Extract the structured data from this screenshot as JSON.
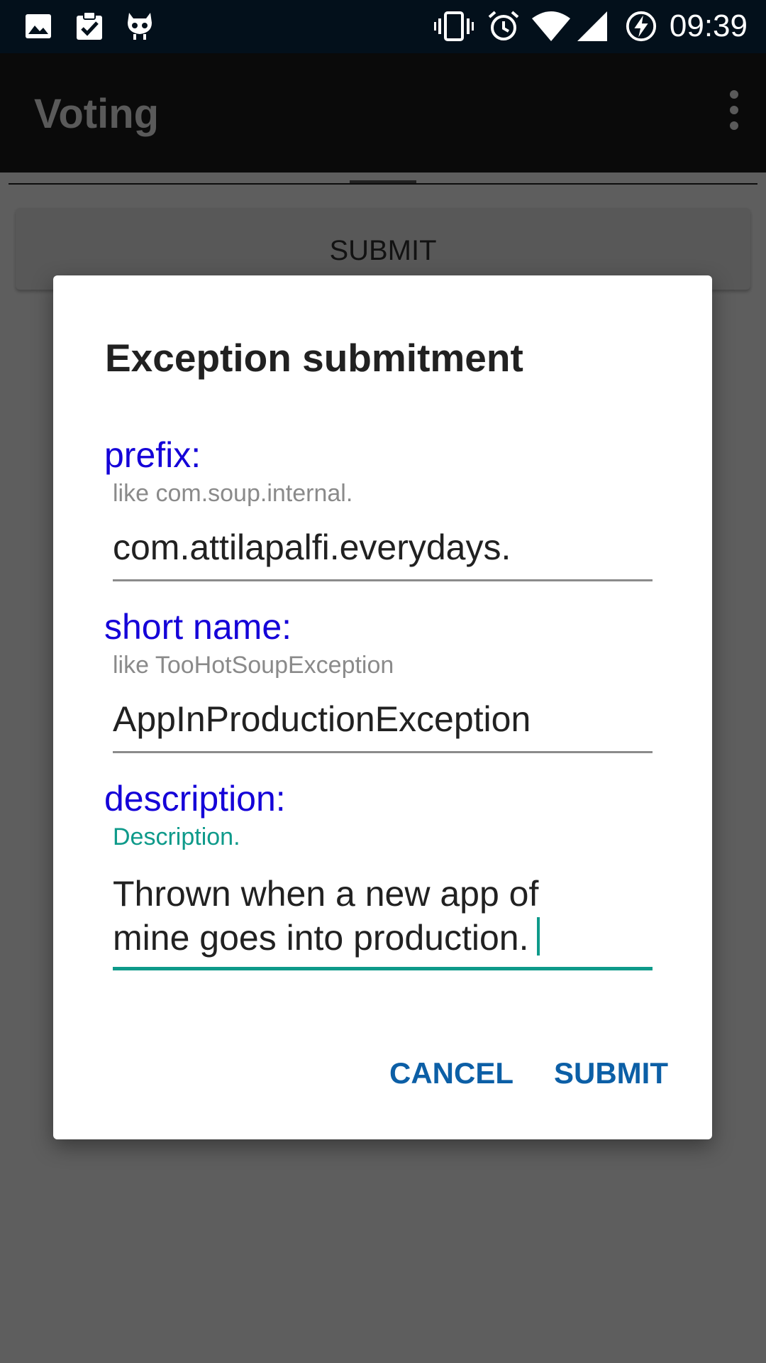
{
  "status_bar": {
    "time": "09:39",
    "icons": [
      "image-icon",
      "clipboard-check-icon",
      "cyanogen-mod-icon",
      "vibrate-icon",
      "alarm-icon",
      "wifi-icon",
      "signal-icon",
      "battery-charging-icon"
    ]
  },
  "app_bar": {
    "title": "Voting",
    "menu_icon": "overflow-menu-icon"
  },
  "background": {
    "submit_label": "SUBMIT"
  },
  "dialog": {
    "title": "Exception submitment",
    "fields": [
      {
        "label": "prefix:",
        "hint": "like com.soup.internal.",
        "value": "com.attilapalfi.everydays."
      },
      {
        "label": "short name:",
        "hint": "like TooHotSoupException",
        "value": "AppInProductionException"
      },
      {
        "label": "description:",
        "hint": "Description.",
        "value_lines": [
          "Thrown when a new app of",
          "mine goes into production."
        ]
      }
    ],
    "cancel_label": "CANCEL",
    "submit_label": "SUBMIT"
  },
  "colors": {
    "accent": "#0e9a8a",
    "label_blue": "#1400d8",
    "button_blue": "#0c5fa6",
    "status_bar": "#03101b"
  }
}
